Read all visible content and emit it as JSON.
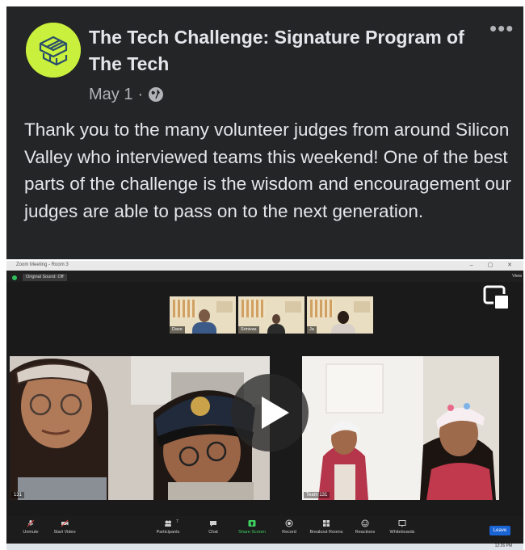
{
  "post": {
    "page_name": "The Tech Challenge: Signature Program of The Tech",
    "date": "May 1",
    "separator": "·",
    "more_icon": "more-options-icon",
    "privacy_icon": "globe-icon",
    "body": "Thank you to the many volunteer judges from around Silicon Valley who interviewed  teams this weekend! One of the best parts of the challenge is the wisdom and encouragement our judges are able to pass on to the next generation.",
    "avatar_color": "#c9f03c"
  },
  "zoom": {
    "window_title": "Zoom Meeting - Room 3",
    "window_controls": "– ▢ ✕",
    "original_sound": "Original Sound: Off",
    "view_label": "View",
    "thumbnails": [
      {
        "name": "Dave"
      },
      {
        "name": "Srinivas"
      },
      {
        "name": "Ja"
      }
    ],
    "tiles": [
      {
        "name": "131"
      },
      {
        "name": "Team 131"
      }
    ],
    "participants_count": "7",
    "toolbar": {
      "unmute": "Unmute",
      "start_video": "Start Video",
      "participants": "Participants",
      "chat": "Chat",
      "share_screen": "Share Screen",
      "record": "Record",
      "breakout_rooms": "Breakout Rooms",
      "reactions": "Reactions",
      "whiteboards": "Whiteboards",
      "leave": "Leave"
    },
    "taskbar_time": "12:26 PM",
    "share_color": "#3ed160",
    "leave_color": "#1a64d6"
  }
}
